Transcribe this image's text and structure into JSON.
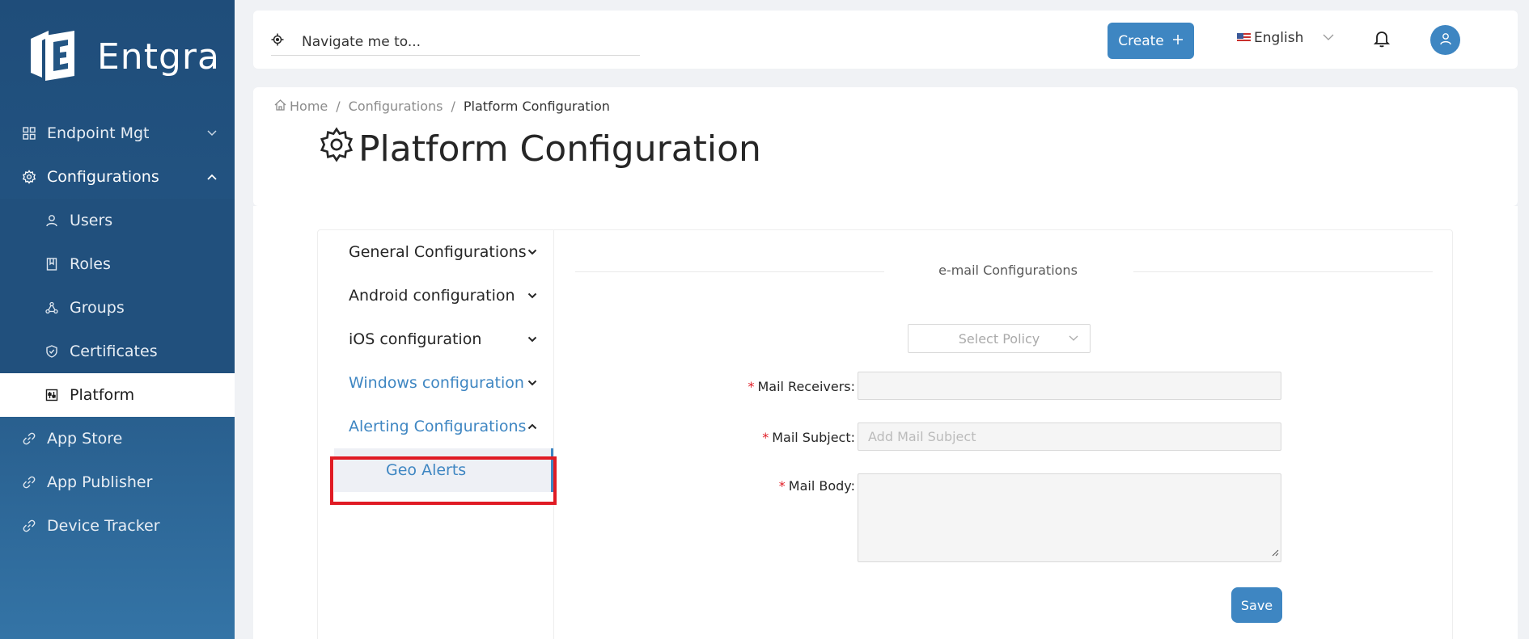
{
  "app": {
    "name": "Entgra"
  },
  "sidebar": {
    "items": [
      {
        "label": "Endpoint Mgt",
        "icon": "grid-icon"
      },
      {
        "label": "Configurations",
        "icon": "gear-icon"
      },
      {
        "label": "Users",
        "icon": "user-icon"
      },
      {
        "label": "Roles",
        "icon": "book-icon"
      },
      {
        "label": "Groups",
        "icon": "nodes-icon"
      },
      {
        "label": "Certificates",
        "icon": "shield-icon"
      },
      {
        "label": "Platform",
        "icon": "sliders-icon"
      },
      {
        "label": "App Store",
        "icon": "link-icon"
      },
      {
        "label": "App Publisher",
        "icon": "link-icon"
      },
      {
        "label": "Device Tracker",
        "icon": "link-icon"
      }
    ]
  },
  "header": {
    "search_placeholder": "Navigate me to...",
    "create_label": "Create",
    "language": "English"
  },
  "breadcrumb": {
    "home": "Home",
    "sep": "/",
    "configurations": "Configurations",
    "current": "Platform Configuration"
  },
  "page": {
    "title": "Platform Configuration"
  },
  "config_menu": {
    "items": [
      {
        "label": "General Configurations"
      },
      {
        "label": "Android configuration"
      },
      {
        "label": "iOS configuration"
      },
      {
        "label": "Windows configuration"
      },
      {
        "label": "Alerting Configurations"
      }
    ],
    "sub_item": "Geo Alerts"
  },
  "form": {
    "section_title": "e-mail Configurations",
    "select_policy": "Select Policy",
    "mail_receivers_label": "Mail Receivers",
    "mail_subject_label": "Mail Subject",
    "mail_subject_placeholder": "Add Mail Subject",
    "mail_body_label": "Mail Body",
    "required_mark": "*",
    "colon": ":",
    "save_label": "Save"
  },
  "colors": {
    "primary": "#3e86c2",
    "sidebar": "#245684",
    "highlight": "#e01b24"
  }
}
